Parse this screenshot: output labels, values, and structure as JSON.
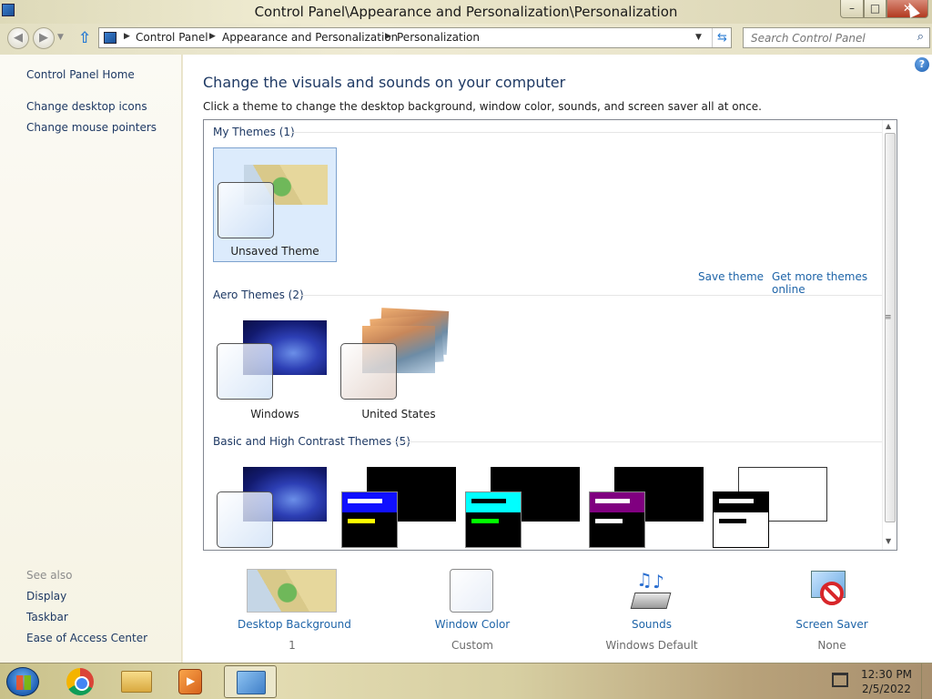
{
  "window": {
    "title": "Control Panel\\Appearance and Personalization\\Personalization",
    "minimize": "–",
    "maximize": "□",
    "close": "✕"
  },
  "nav": {
    "back_icon": "back-arrow-icon",
    "forward_icon": "forward-arrow-icon",
    "breadcrumbs": [
      "Control Panel",
      "Appearance and Personalization",
      "Personalization"
    ],
    "search_placeholder": "Search Control Panel"
  },
  "sidebar": {
    "home": "Control Panel Home",
    "links": [
      "Change desktop icons",
      "Change mouse pointers"
    ],
    "see_also_label": "See also",
    "see_also": [
      "Display",
      "Taskbar",
      "Ease of Access Center"
    ]
  },
  "main": {
    "help": "?",
    "heading": "Change the visuals and sounds on your computer",
    "subheading": "Click a theme to change the desktop background, window color, sounds, and screen saver all at once.",
    "my_themes_header": "My Themes (1)",
    "my_themes": [
      {
        "label": "Unsaved Theme",
        "selected": true
      }
    ],
    "save_theme": "Save theme",
    "get_more": "Get more themes online",
    "aero_header": "Aero Themes (2)",
    "aero_themes": [
      {
        "label": "Windows"
      },
      {
        "label": "United States"
      }
    ],
    "basic_header": "Basic and High Contrast Themes (5)"
  },
  "bottom": {
    "items": [
      {
        "link": "Desktop Background",
        "value": "1"
      },
      {
        "link": "Window Color",
        "value": "Custom"
      },
      {
        "link": "Sounds",
        "value": "Windows Default"
      },
      {
        "link": "Screen Saver",
        "value": "None"
      }
    ]
  },
  "taskbar": {
    "time": "12:30 PM",
    "date": "2/5/2022",
    "apps": [
      "chrome-icon",
      "file-explorer-icon",
      "media-player-icon",
      "control-panel-icon"
    ]
  },
  "colors": {
    "link": "#1e64a8",
    "heading": "#1e3964",
    "selected_tile": "#dcebfc"
  }
}
